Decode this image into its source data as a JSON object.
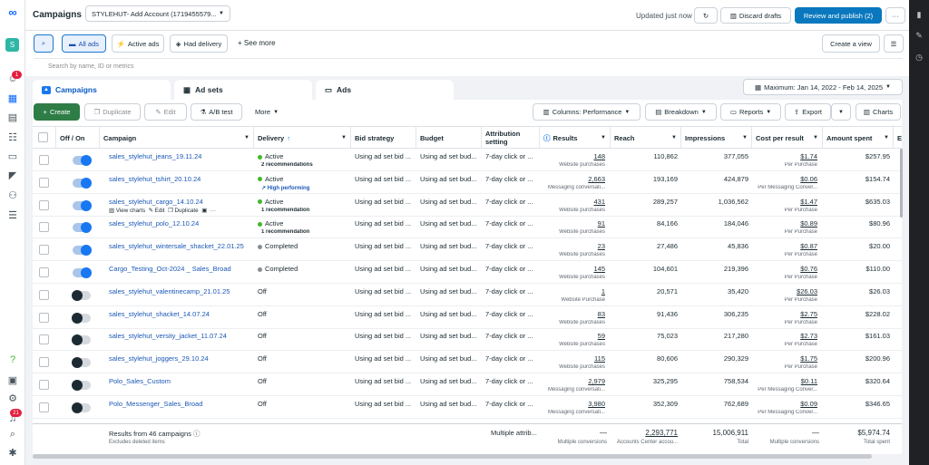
{
  "header": {
    "title": "Campaigns",
    "account": "STYLEHUT- Add Account (1719455579...",
    "updated": "Updated just now",
    "discard": "Discard drafts",
    "review": "Review and publish (2)",
    "more": "···"
  },
  "filters": {
    "all_ads": "All ads",
    "active_ads": "Active ads",
    "had_delivery": "Had delivery",
    "see_more": "See more",
    "create_view": "Create a view",
    "search_placeholder": "Search by name, ID or metrics"
  },
  "tabs": {
    "campaigns": "Campaigns",
    "ad_sets": "Ad sets",
    "ads": "Ads"
  },
  "date_range": "Maximum: Jan 14, 2022 - Feb 14, 2025",
  "toolbar": {
    "create": "Create",
    "duplicate": "Duplicate",
    "edit": "Edit",
    "ab_test": "A/B test",
    "more": "More",
    "columns": "Columns: Performance",
    "breakdown": "Breakdown",
    "reports": "Reports",
    "export": "Export",
    "charts": "Charts"
  },
  "columns": [
    "Off / On",
    "Campaign",
    "Delivery",
    "Bid strategy",
    "Budget",
    "Attribution setting",
    "Results",
    "Reach",
    "Impressions",
    "Cost per result",
    "Amount spent",
    "En"
  ],
  "row_actions": {
    "view_charts": "View charts",
    "edit": "Edit",
    "duplicate": "Duplicate"
  },
  "rows": [
    {
      "on": true,
      "name": "sales_stylehut_jeans_19.11.24",
      "status": "Active",
      "sub": "2 recommendations",
      "bid": "Using ad set bid ...",
      "budget": "Using ad set bud...",
      "attr": "7-day click or ...",
      "results": "148",
      "result_type": "Website purchases",
      "reach": "110,862",
      "impr": "377,055",
      "cpr": "$1.74",
      "cpr_type": "Per Purchase",
      "spent": "$257.95"
    },
    {
      "on": true,
      "name": "sales_stylehut_tshirt_20.10.24",
      "status": "Active",
      "sub": "High performing",
      "bid": "Using ad set bid ...",
      "budget": "Using ad set bud...",
      "attr": "7-day click or ...",
      "results": "2,663",
      "result_type": "Messaging conversati...",
      "reach": "193,169",
      "impr": "424,879",
      "cpr": "$0.06",
      "cpr_type": "Per Messaging Conver...",
      "spent": "$154.74"
    },
    {
      "on": true,
      "name": "sales_stylehut_cargo_14.10.24",
      "status": "Active",
      "sub": "1 recommendation",
      "bid": "Using ad set bid ...",
      "budget": "Using ad set bud...",
      "attr": "7-day click or ...",
      "results": "431",
      "result_type": "Website purchases",
      "reach": "289,257",
      "impr": "1,036,562",
      "cpr": "$1.47",
      "cpr_type": "Per Purchase",
      "spent": "$635.03"
    },
    {
      "on": true,
      "name": "sales_stylehut_polo_12.10.24",
      "status": "Active",
      "sub": "1 recommendation",
      "bid": "Using ad set bid ...",
      "budget": "Using ad set bud...",
      "attr": "7-day click or ...",
      "results": "91",
      "result_type": "Website purchases",
      "reach": "84,166",
      "impr": "184,046",
      "cpr": "$0.89",
      "cpr_type": "Per Purchase",
      "spent": "$80.96"
    },
    {
      "on": true,
      "name": "sales_stylehut_wintersale_shacket_22.01.25",
      "status": "Completed",
      "sub": "",
      "bid": "Using ad set bid ...",
      "budget": "Using ad set bud...",
      "attr": "7-day click or ...",
      "results": "23",
      "result_type": "Website purchases",
      "reach": "27,486",
      "impr": "45,836",
      "cpr": "$0.87",
      "cpr_type": "Per Purchase",
      "spent": "$20.00"
    },
    {
      "on": true,
      "name": "Cargo_Testing_Oct-2024 _ Sales_Broad",
      "status": "Completed",
      "sub": "",
      "bid": "Using ad set bid ...",
      "budget": "Using ad set bud...",
      "attr": "7-day click or ...",
      "results": "145",
      "result_type": "Website purchases",
      "reach": "104,601",
      "impr": "219,396",
      "cpr": "$0.76",
      "cpr_type": "Per Purchase",
      "spent": "$110.00"
    },
    {
      "on": false,
      "name": "sales_stylehut_valentinecamp_21.01.25",
      "status": "Off",
      "sub": "",
      "bid": "Using ad set bid ...",
      "budget": "Using ad set bud...",
      "attr": "7-day click or ...",
      "results": "1",
      "result_type": "Website Purchase",
      "reach": "20,571",
      "impr": "35,420",
      "cpr": "$26.03",
      "cpr_type": "Per Purchase",
      "spent": "$26.03"
    },
    {
      "on": false,
      "name": "sales_stylehut_shacket_14.07.24",
      "status": "Off",
      "sub": "",
      "bid": "Using ad set bid ...",
      "budget": "Using ad set bud...",
      "attr": "7-day click or ...",
      "results": "83",
      "result_type": "Website purchases",
      "reach": "91,436",
      "impr": "306,235",
      "cpr": "$2.75",
      "cpr_type": "Per Purchase",
      "spent": "$228.02"
    },
    {
      "on": false,
      "name": "sales_stylehut_versity_jacket_11.07.24",
      "status": "Off",
      "sub": "",
      "bid": "Using ad set bid ...",
      "budget": "Using ad set bud...",
      "attr": "7-day click or ...",
      "results": "59",
      "result_type": "Website purchases",
      "reach": "75,023",
      "impr": "217,280",
      "cpr": "$2.73",
      "cpr_type": "Per Purchase",
      "spent": "$161.03"
    },
    {
      "on": false,
      "name": "sales_stylehut_joggers_29.10.24",
      "status": "Off",
      "sub": "",
      "bid": "Using ad set bid ...",
      "budget": "Using ad set bud...",
      "attr": "7-day click or ...",
      "results": "115",
      "result_type": "Website purchases",
      "reach": "80,606",
      "impr": "290,329",
      "cpr": "$1.75",
      "cpr_type": "Per Purchase",
      "spent": "$200.96"
    },
    {
      "on": false,
      "name": "Polo_Sales_Custom",
      "status": "Off",
      "sub": "",
      "bid": "Using ad set bid ...",
      "budget": "Using ad set bud...",
      "attr": "7-day click or ...",
      "results": "2,979",
      "result_type": "Messaging conversati...",
      "reach": "325,295",
      "impr": "758,534",
      "cpr": "$0.11",
      "cpr_type": "Per Messaging Conver...",
      "spent": "$320.64"
    },
    {
      "on": false,
      "name": "Polo_Messenger_Sales_Broad",
      "status": "Off",
      "sub": "",
      "bid": "Using ad set bid ...",
      "budget": "Using ad set bud...",
      "attr": "7-day click or ...",
      "results": "3,980",
      "result_type": "Messaging conversati...",
      "reach": "352,309",
      "impr": "762,689",
      "cpr": "$0.09",
      "cpr_type": "Per Messaging Conver...",
      "spent": "$346.65"
    }
  ],
  "footer": {
    "results_from": "Results from 46 campaigns",
    "excludes": "Excludes deleted items",
    "attr": "Multiple attrib...",
    "results": "—",
    "results_sub": "Multiple conversions",
    "reach": "2,293,771",
    "reach_sub": "Accounts Center accou...",
    "impr": "15,006,911",
    "impr_sub": "Total",
    "cpr": "—",
    "cpr_sub": "Multiple conversions",
    "spent": "$5,974.74",
    "spent_sub": "Total spent"
  },
  "notifications": {
    "top_badge": "1",
    "bottom_badge": "21"
  },
  "avatar_letter": "S",
  "colors": {
    "accent": "#0a78be",
    "create": "#2e7d47",
    "link": "#1a58b6",
    "active": "#42b72a",
    "completed": "#8a8d91"
  }
}
